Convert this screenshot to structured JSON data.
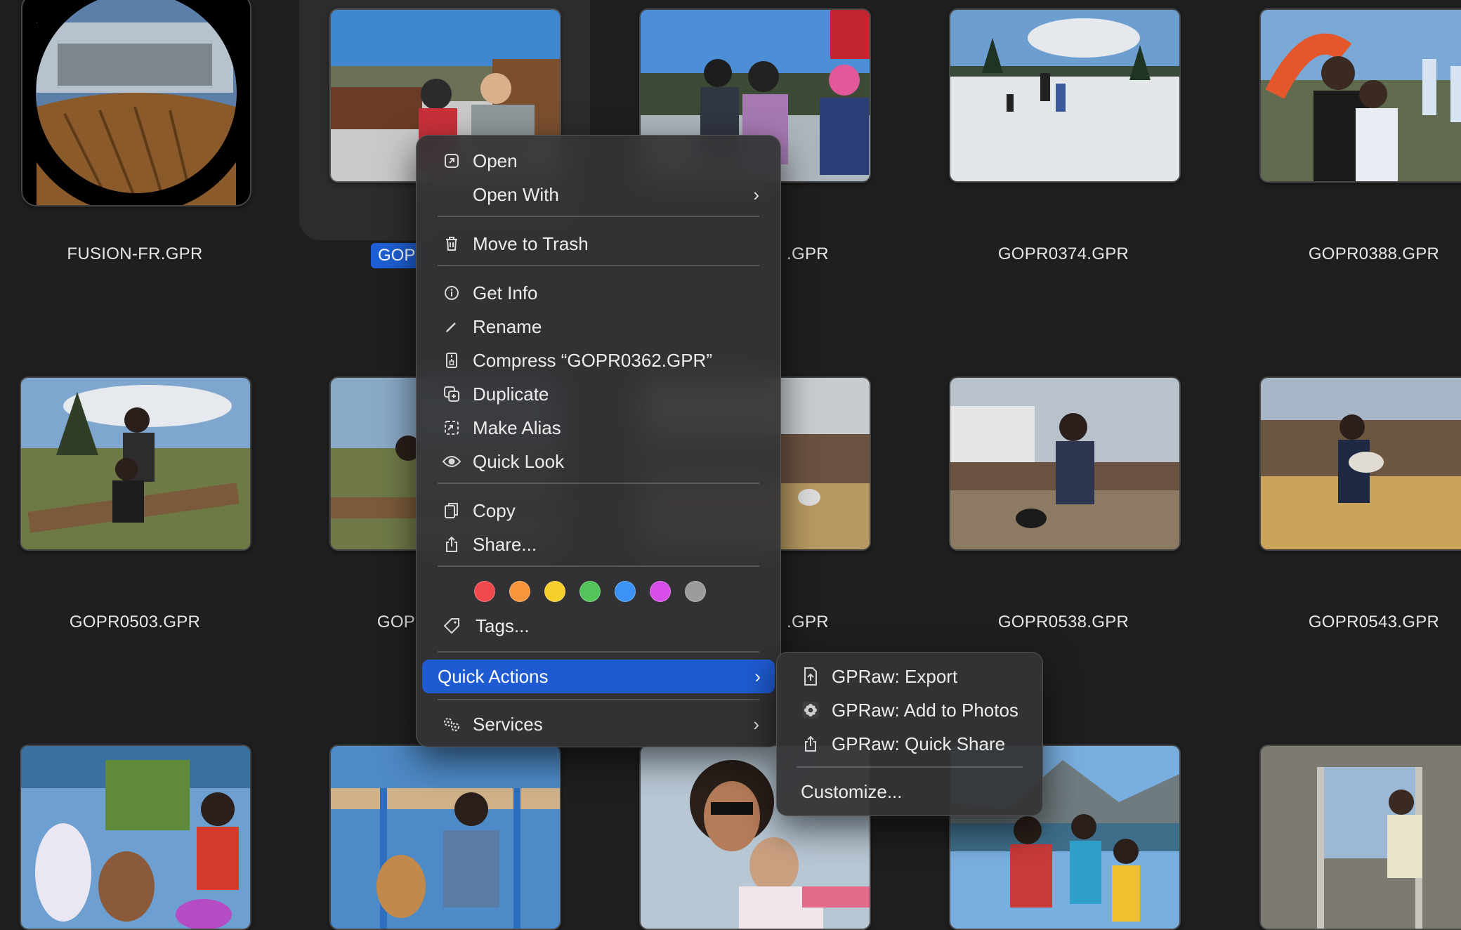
{
  "files": [
    {
      "name": "FUSION-FR.GPR"
    },
    {
      "name": "GOPR0362.GPR",
      "visible_label": "GOP"
    },
    {
      "name": ".GPR"
    },
    {
      "name": "GOPR0374.GPR"
    },
    {
      "name": "GOPR0388.GPR"
    },
    {
      "name": "GOPR0503.GPR"
    },
    {
      "name": "GOP"
    },
    {
      "name": ".GPR"
    },
    {
      "name": "GOPR0538.GPR"
    },
    {
      "name": "GOPR0543.GPR"
    }
  ],
  "context_menu": {
    "open": "Open",
    "open_with": "Open With",
    "move_to_trash": "Move to Trash",
    "get_info": "Get Info",
    "rename": "Rename",
    "compress": "Compress “GOPR0362.GPR”",
    "duplicate": "Duplicate",
    "make_alias": "Make Alias",
    "quick_look": "Quick Look",
    "copy": "Copy",
    "share": "Share...",
    "tag_colors": [
      "#f0484d",
      "#f7953c",
      "#f6cf2d",
      "#52c45a",
      "#3d93f5",
      "#d74ee8",
      "#9c9c9f"
    ],
    "tags": "Tags...",
    "quick_actions": "Quick Actions",
    "services": "Services"
  },
  "quick_actions_submenu": {
    "export": "GPRaw: Export",
    "add_to_photos": "GPRaw: Add to Photos",
    "quick_share": "GPRaw: Quick Share",
    "customize": "Customize..."
  },
  "colors": {
    "highlight": "#1e5bd1",
    "background": "#1f1f1f"
  }
}
